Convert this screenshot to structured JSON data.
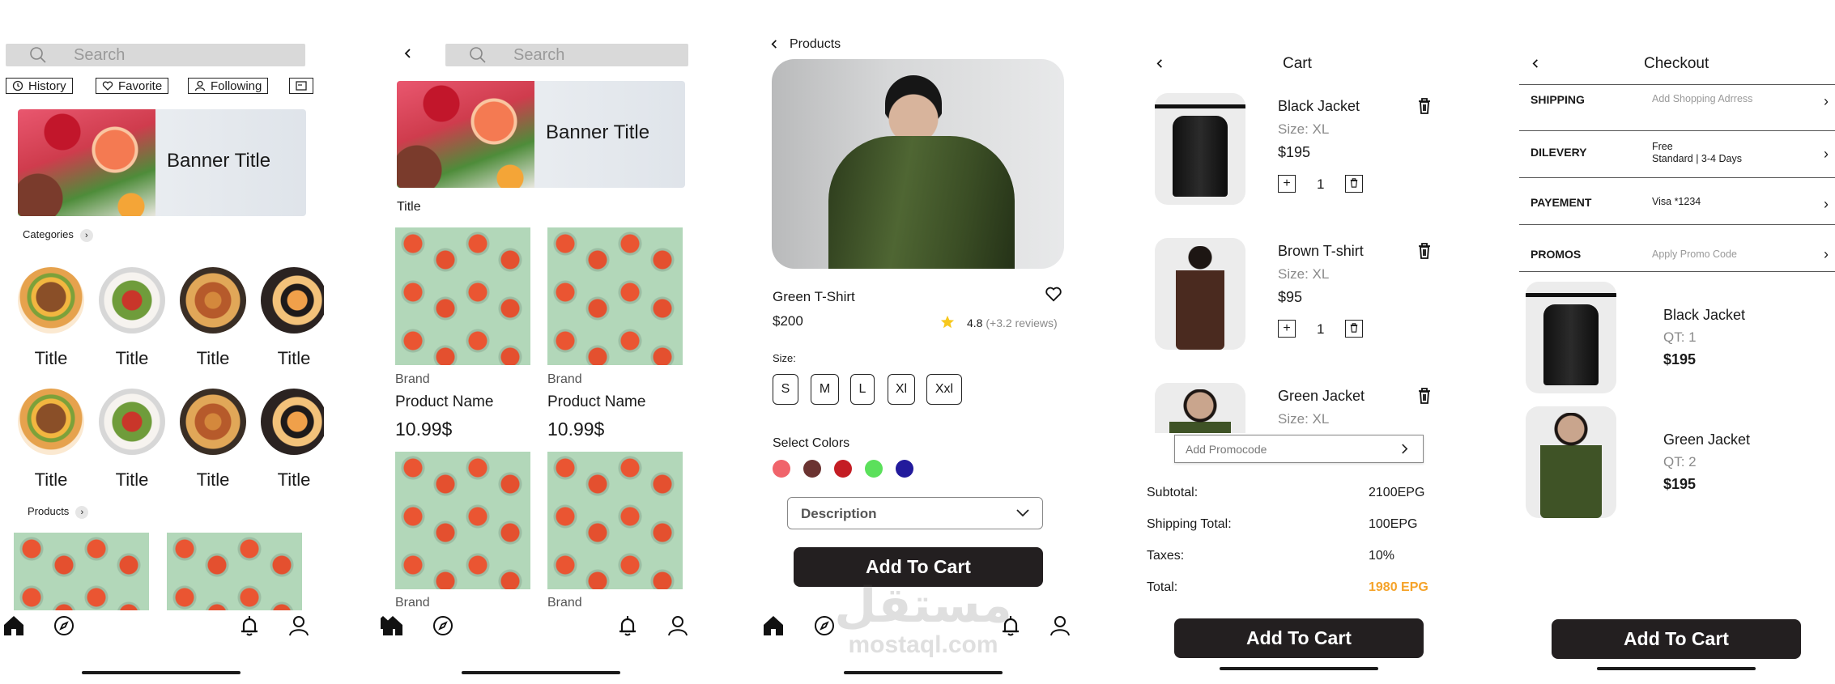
{
  "screen1": {
    "search_placeholder": "Search",
    "chips": [
      "History",
      "Favorite",
      "Following"
    ],
    "banner_title": "Banner Title",
    "categories_label": "Categories",
    "category_titles": [
      "Title",
      "Title",
      "Title",
      "Title",
      "Title",
      "Title",
      "Title",
      "Title"
    ],
    "products_label": "Products"
  },
  "screen2": {
    "search_placeholder": "Search",
    "banner_title": "Banner Title",
    "section_title": "Title",
    "products": [
      {
        "brand": "Brand",
        "name": "Product Name",
        "price": "10.99$"
      },
      {
        "brand": "Brand",
        "name": "Product Name",
        "price": "10.99$"
      }
    ],
    "bottom_brands": [
      "Brand",
      "Brand"
    ]
  },
  "screen3": {
    "back_label": "Products",
    "product_name": "Green T-Shirt",
    "price": "$200",
    "rating": "4.8",
    "reviews": "(+3.2 reviews)",
    "size_label": "Size:",
    "sizes": [
      "S",
      "M",
      "L",
      "Xl",
      "Xxl"
    ],
    "colors_label": "Select Colors",
    "colors": [
      "#f0646b",
      "#6b3331",
      "#c41d24",
      "#5be05b",
      "#221a9c"
    ],
    "description_label": "Description",
    "add_button": "Add To Cart"
  },
  "screen4": {
    "title": "Cart",
    "items": [
      {
        "name": "Black Jacket",
        "size": "Size: XL",
        "price": "$195",
        "qty": "1"
      },
      {
        "name": "Brown T-shirt",
        "size": "Size: XL",
        "price": "$95",
        "qty": "1"
      },
      {
        "name": "Green Jacket",
        "size": "Size: XL"
      }
    ],
    "promo_placeholder": "Add Promocode",
    "subtotal_label": "Subtotal:",
    "subtotal": "2100EPG",
    "shipping_label": "Shipping Total:",
    "shipping": "100EPG",
    "taxes_label": "Taxes:",
    "taxes": "10%",
    "total_label": "Total:",
    "total": "1980 EPG",
    "total_color": "#f5a32a",
    "add_button": "Add To Cart"
  },
  "screen5": {
    "title": "Checkout",
    "rows": [
      {
        "label": "SHIPPING",
        "value": "Add Shopping Adrress"
      },
      {
        "label": "DILEVERY",
        "value": "Free",
        "value2": "Standard | 3-4 Days"
      },
      {
        "label": "PAYEMENT",
        "value": "Visa *1234"
      },
      {
        "label": "PROMOS",
        "value": "Apply Promo Code"
      }
    ],
    "items": [
      {
        "name": "Black Jacket",
        "qty": "QT: 1",
        "price": "$195"
      },
      {
        "name": "Green Jacket",
        "qty": "QT: 2",
        "price": "$195"
      }
    ],
    "add_button": "Add To Cart"
  },
  "watermark": {
    "arabic": "مستقل",
    "latin": "mostaql.com"
  }
}
